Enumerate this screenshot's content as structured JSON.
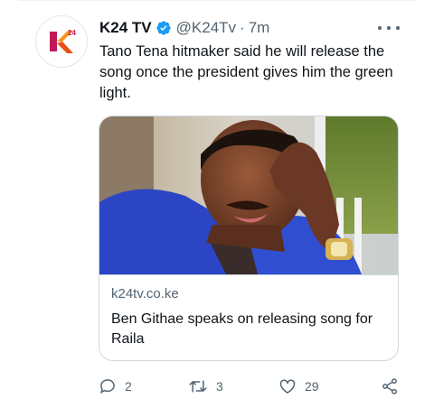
{
  "tweet": {
    "author_name": "K24 TV",
    "handle": "@K24Tv",
    "separator": "·",
    "time": "7m",
    "text": "Tano Tena hitmaker said he will release the song once the president gives him the green light.",
    "avatar_logo": "K24",
    "avatar_logo_sup": "24"
  },
  "card": {
    "domain": "k24tv.co.ke",
    "title": "Ben Githae speaks on releasing song for Raila"
  },
  "actions": {
    "reply_count": "2",
    "retweet_count": "3",
    "like_count": "29"
  },
  "colors": {
    "verified": "#1d9bf0",
    "secondary_text": "#536471",
    "border": "#cfd9de",
    "logo_orange": "#f7941d",
    "logo_magenta": "#c2185b"
  },
  "icons": [
    "verified-badge-icon",
    "more-icon",
    "reply-icon",
    "retweet-icon",
    "like-icon",
    "share-icon"
  ]
}
